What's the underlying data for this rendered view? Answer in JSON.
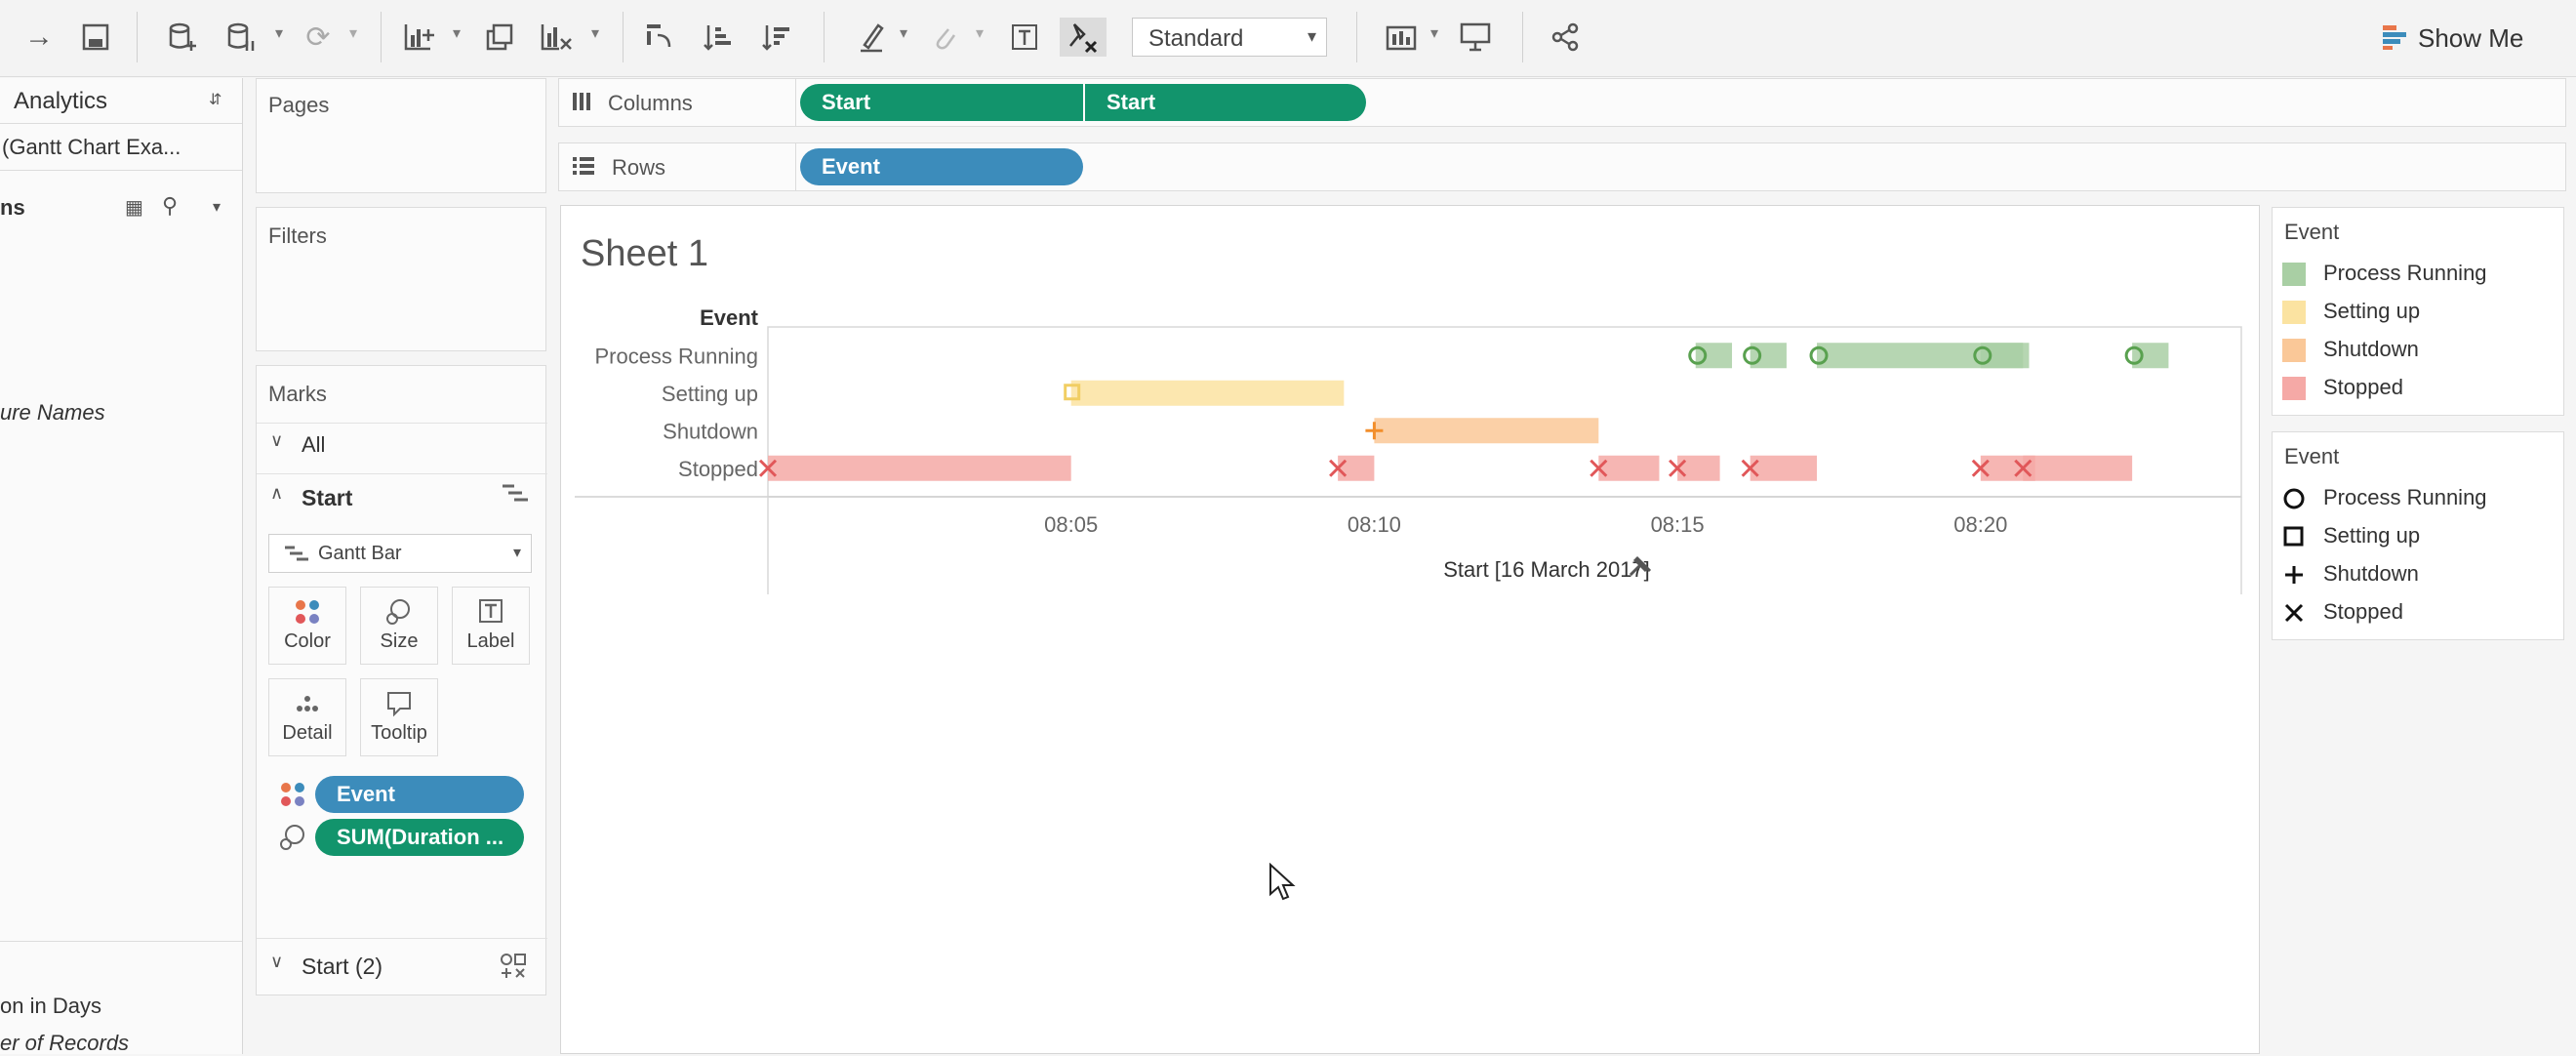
{
  "toolbar": {
    "fit_value": "Standard",
    "show_me_label": "Show Me"
  },
  "datapane": {
    "analytics_tab": "Analytics",
    "datasource": "(Gantt Chart Exa...",
    "section_label": "ns",
    "fields_top": [
      "ure Names"
    ],
    "fields_bottom": [
      "on in Days",
      "er of Records"
    ]
  },
  "pages": {
    "title": "Pages"
  },
  "filters": {
    "title": "Filters"
  },
  "columns": {
    "label": "Columns",
    "pills": [
      "Start",
      "Start"
    ]
  },
  "rows": {
    "label": "Rows",
    "pills": [
      "Event"
    ]
  },
  "marks": {
    "title": "Marks",
    "all_label": "All",
    "start_label": "Start",
    "mark_type": "Gantt Bar",
    "buttons": [
      "Color",
      "Size",
      "Label",
      "Detail",
      "Tooltip"
    ],
    "pills": [
      "Event",
      "SUM(Duration ..."
    ],
    "start2_label": "Start (2)"
  },
  "sheet": {
    "title": "Sheet 1"
  },
  "legend_color": {
    "title": "Event",
    "items": [
      {
        "label": "Process Running",
        "color": "#a9cfa4"
      },
      {
        "label": "Setting up",
        "color": "#fbe3a1"
      },
      {
        "label": "Shutdown",
        "color": "#fac898"
      },
      {
        "label": "Stopped",
        "color": "#f5a9a6"
      }
    ]
  },
  "legend_shape": {
    "title": "Event",
    "items": [
      {
        "label": "Process Running",
        "shape": "circle"
      },
      {
        "label": "Setting up",
        "shape": "square"
      },
      {
        "label": "Shutdown",
        "shape": "plus"
      },
      {
        "label": "Stopped",
        "shape": "cross"
      }
    ]
  },
  "chart_data": {
    "type": "gantt",
    "row_header": "Event",
    "categories": [
      "Process Running",
      "Setting up",
      "Shutdown",
      "Stopped"
    ],
    "x_ticks": [
      "08:05",
      "08:10",
      "08:15",
      "08:20"
    ],
    "x_axis_label": "Start [16 March 2017]",
    "x_range_minutes": [
      0,
      24.3
    ],
    "tick_values_minutes": [
      5,
      10,
      15,
      20
    ],
    "bars": [
      {
        "event": "Process Running",
        "start": 15.3,
        "end": 15.9,
        "shape": "circle"
      },
      {
        "event": "Process Running",
        "start": 16.2,
        "end": 16.8,
        "shape": "circle"
      },
      {
        "event": "Process Running",
        "start": 17.3,
        "end": 20.7,
        "shape": "circle"
      },
      {
        "event": "Process Running",
        "start": 20.0,
        "end": 20.8,
        "shape": "circle"
      },
      {
        "event": "Process Running",
        "start": 22.5,
        "end": 23.1,
        "shape": "circle"
      },
      {
        "event": "Setting up",
        "start": 5.0,
        "end": 9.5,
        "shape": "square"
      },
      {
        "event": "Shutdown",
        "start": 10.0,
        "end": 13.7,
        "shape": "plus"
      },
      {
        "event": "Stopped",
        "start": 0.0,
        "end": 5.0,
        "shape": "cross"
      },
      {
        "event": "Stopped",
        "start": 9.4,
        "end": 10.0,
        "shape": "cross"
      },
      {
        "event": "Stopped",
        "start": 13.7,
        "end": 14.7,
        "shape": "cross"
      },
      {
        "event": "Stopped",
        "start": 15.0,
        "end": 15.7,
        "shape": "cross"
      },
      {
        "event": "Stopped",
        "start": 16.2,
        "end": 17.3,
        "shape": "cross"
      },
      {
        "event": "Stopped",
        "start": 20.0,
        "end": 20.9,
        "shape": "cross"
      },
      {
        "event": "Stopped",
        "start": 20.7,
        "end": 22.5,
        "shape": "cross"
      }
    ]
  }
}
